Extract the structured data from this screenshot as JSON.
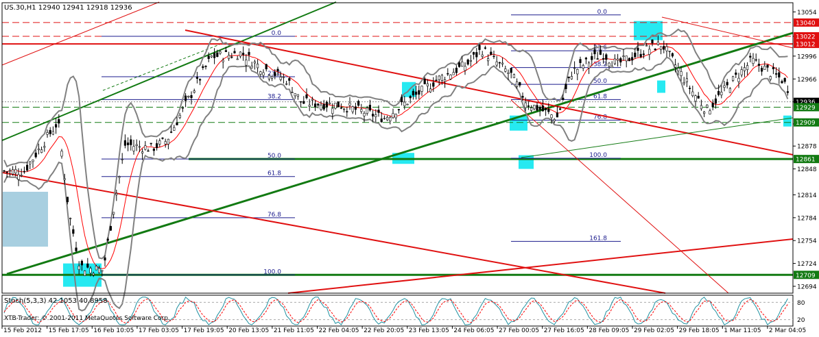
{
  "header": {
    "symbol_line": "US.30,H1  12940 12941 12918 12936"
  },
  "indicator": {
    "label": "Stoch(5,3,3) 42.1053 40.8958",
    "ticks": [
      "80",
      "20"
    ]
  },
  "watermark": "XTB-Trader: © 2001-2011 MetaQuotes Software Corp.",
  "colors": {
    "background": "#ffffff",
    "price_bars": "#000000",
    "bollinger": "#808080",
    "moving_average": "#ff0000",
    "trend_red": "#e01010",
    "trend_green": "#127a12",
    "fib_lines": "#1a1a8c",
    "highlight_box": "#00e5ee",
    "zone_box": "#a8cfe0",
    "stoch_main": "#1e90a0",
    "stoch_signal": "#ff0000",
    "current_price_tag": "#000000"
  },
  "chart_data": {
    "type": "candlestick",
    "symbol": "US.30",
    "timeframe": "H1",
    "ohlc": {
      "open": 12940,
      "high": 12941,
      "low": 12918,
      "close": 12936
    },
    "y_ticks": [
      13054,
      13022,
      12996,
      12966,
      12936,
      12907,
      12878,
      12848,
      12814,
      12784,
      12754,
      12724,
      12694
    ],
    "ylim": [
      12685,
      13066
    ],
    "x_ticks": [
      "15 Feb 2012",
      "15 Feb 17:05",
      "16 Feb 10:05",
      "17 Feb 03:05",
      "17 Feb 19:05",
      "20 Feb 13:05",
      "21 Feb 11:05",
      "22 Feb 04:05",
      "22 Feb 20:05",
      "23 Feb 13:05",
      "24 Feb 06:05",
      "27 Feb 00:05",
      "27 Feb 16:05",
      "28 Feb 09:05",
      "29 Feb 02:05",
      "29 Feb 18:05",
      "1 Mar 11:05",
      "2 Mar 04:05"
    ],
    "price_levels": [
      {
        "label": "13040",
        "value": 13040,
        "style": "red-dashed"
      },
      {
        "label": "13022",
        "value": 13022,
        "style": "red-dashed"
      },
      {
        "label": "13012",
        "value": 13012,
        "style": "red-solid"
      },
      {
        "label": "12936",
        "value": 12936,
        "style": "current-price"
      },
      {
        "label": "12929",
        "value": 12929,
        "style": "green-dashed"
      },
      {
        "label": "12909",
        "value": 12909,
        "style": "green-dashed"
      },
      {
        "label": "12861",
        "value": 12861,
        "style": "green-solid"
      },
      {
        "label": "12709",
        "value": 12709,
        "style": "green-solid"
      }
    ],
    "fibonacci_labels": [
      "0.0",
      "23.6",
      "38.2",
      "50.0",
      "61.8",
      "76.8",
      "100.0",
      "161.8"
    ],
    "close_path": [
      [
        "15 Feb 2012",
        12845
      ],
      [
        "15 Feb 17:05",
        12910
      ],
      [
        "15 Feb 17:05",
        12790
      ],
      [
        "15 Feb 17:05",
        12720
      ],
      [
        "16 Feb 10:05",
        12715
      ],
      [
        "16 Feb 10:05",
        12800
      ],
      [
        "16 Feb 10:05",
        12880
      ],
      [
        "17 Feb 03:05",
        12875
      ],
      [
        "17 Feb 03:05",
        12885
      ],
      [
        "17 Feb 19:05",
        12960
      ],
      [
        "17 Feb 19:05",
        12995
      ],
      [
        "20 Feb 13:05",
        13000
      ],
      [
        "20 Feb 13:05",
        12985
      ],
      [
        "21 Feb 11:05",
        12965
      ],
      [
        "21 Feb 11:05",
        12935
      ],
      [
        "22 Feb 04:05",
        12932
      ],
      [
        "22 Feb 20:05",
        12915
      ],
      [
        "23 Feb 13:05",
        12950
      ],
      [
        "23 Feb 13:05",
        12965
      ],
      [
        "24 Feb 06:05",
        12985
      ],
      [
        "24 Feb 06:05",
        13005
      ],
      [
        "27 Feb 00:05",
        12970
      ],
      [
        "27 Feb 00:05",
        12935
      ],
      [
        "27 Feb 16:05",
        12915
      ],
      [
        "27 Feb 16:05",
        12975
      ],
      [
        "28 Feb 09:05",
        13000
      ],
      [
        "28 Feb 09:05",
        12985
      ],
      [
        "29 Feb 02:05",
        13005
      ],
      [
        "29 Feb 02:05",
        13012
      ],
      [
        "29 Feb 18:05",
        12950
      ],
      [
        "29 Feb 18:05",
        12925
      ],
      [
        "1 Mar 11:05",
        12970
      ],
      [
        "1 Mar 11:05",
        12990
      ],
      [
        "2 Mar 04:05",
        12965
      ],
      [
        "2 Mar 04:05",
        12936
      ]
    ]
  }
}
